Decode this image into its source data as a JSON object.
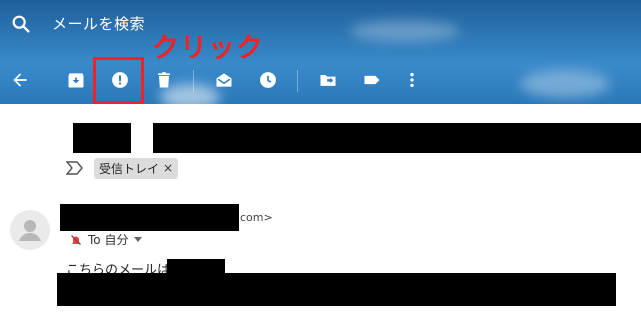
{
  "search": {
    "placeholder_text": "メールを検索",
    "icon": "search-icon"
  },
  "annotation": {
    "click_label": "クリック",
    "highlight_color": "#ee2424"
  },
  "toolbar": {
    "buttons": [
      {
        "name": "back",
        "icon": "arrow-left-icon"
      },
      {
        "name": "archive",
        "icon": "archive-icon"
      },
      {
        "name": "report-spam",
        "icon": "report-spam-icon"
      },
      {
        "name": "delete",
        "icon": "trash-icon"
      },
      {
        "name": "mark-unread",
        "icon": "mark-unread-icon"
      },
      {
        "name": "snooze",
        "icon": "clock-icon"
      },
      {
        "name": "move-to",
        "icon": "move-to-folder-icon"
      },
      {
        "name": "labels",
        "icon": "label-icon"
      },
      {
        "name": "more",
        "icon": "more-vert-icon"
      }
    ]
  },
  "message": {
    "label_chip": "受信トレイ",
    "label_chip_close": "×",
    "sender_address_tail": "com>",
    "to_text": "To 自分",
    "body_text": "こちらのメールは"
  },
  "colors": {
    "header_accent": "#2f7ab8",
    "chip_bg": "#dcdcdc"
  }
}
